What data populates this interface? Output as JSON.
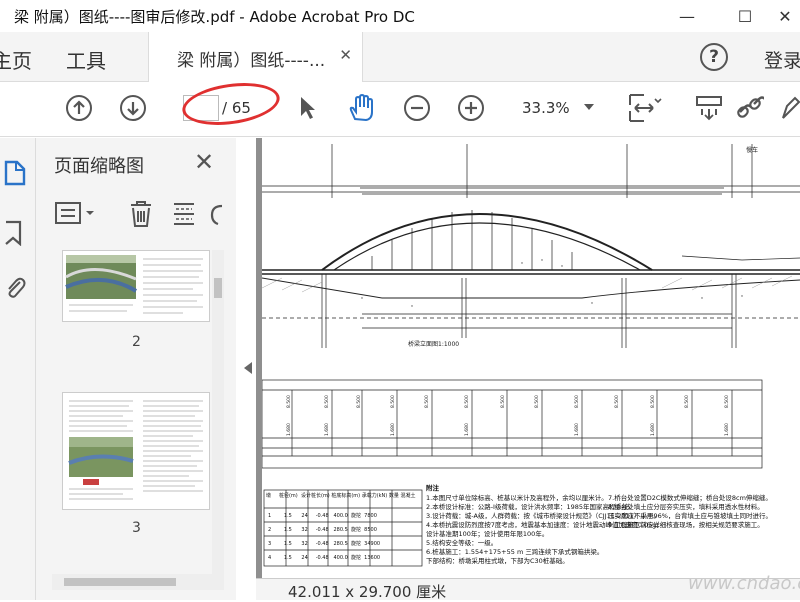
{
  "window": {
    "title": "梁 附属）图纸----图审后修改.pdf - Adobe Acrobat Pro DC",
    "minimize": "—",
    "maximize": "☐",
    "close": "✕"
  },
  "nav": {
    "home": "主页",
    "tools": "工具",
    "doc_tab": "梁 附属）图纸----...",
    "doc_tab_close": "✕",
    "help": "?",
    "login": "登录"
  },
  "toolbar": {
    "page_current": "",
    "page_total": "/ 65",
    "zoom": "33.3%"
  },
  "panel": {
    "title": "页面缩略图",
    "close": "✕",
    "thumbnails": [
      {
        "page": "2"
      },
      {
        "page": "3"
      }
    ]
  },
  "status": {
    "dimensions": "42.011 x 29.700 厘米"
  },
  "watermark": "www.cndao.com",
  "drawing": {
    "label_right": "慢车",
    "section_title": "桥梁立面图",
    "scale": "1:1000",
    "notes_title": "附注",
    "notes_left": [
      "1.本图尺寸单位除标高、桩基以米计及高程外，余均以厘米计。",
      "2.本桥设计标准：公路-I级荷载，设计洪水频率：1985年国家高程系统。",
      "3.设计荷载：城-A级，人群荷载：按《城市桥梁设计规范》（CJJ11-2011）采用。",
      "4.本桥抗震设防烈度按7度考虑，地震基本加速度：设计地震动峰值加速度0.05g。",
      "  设计基准期100年；设计使用年限100年。",
      "5.结构安全等级：一级。",
      "6.桩基施工：1.554+175+55 m 三跨连续下承式钢箱拱梁。",
      "  下部结构：桥墩采用柱式墩，下部为C30桩基础。"
    ],
    "notes_right": [
      "7.桥台处设置D2C模数式伸缩缝；桥台处设8cm伸缩缝。",
      "8.桥台处填土应分层夯实压实，填料采用透水性材料。",
      "  压实度应不小于96%，台背填土应与锥坡填土同时进行。",
      "9.工程施工前应详细核查现场，按相关规范要求施工。"
    ],
    "pile_table": {
      "headers": [
        "墩",
        "桩径(m)",
        "设计桩长(m)",
        "桩底标高(m)",
        "承载力(kN)",
        "数量",
        "混凝土"
      ],
      "rows": [
        [
          "1",
          "1.5",
          "24",
          "-0.48",
          "400.0",
          "旋挖",
          "7800"
        ],
        [
          "2",
          "1.5",
          "32",
          "-0.48",
          "280.5",
          "旋挖",
          "8500"
        ],
        [
          "3",
          "1.5",
          "32",
          "-0.48",
          "280.5",
          "旋挖",
          "34900"
        ],
        [
          "4",
          "1.5",
          "24",
          "-0.48",
          "400.0",
          "旋挖",
          "13600"
        ]
      ]
    }
  }
}
